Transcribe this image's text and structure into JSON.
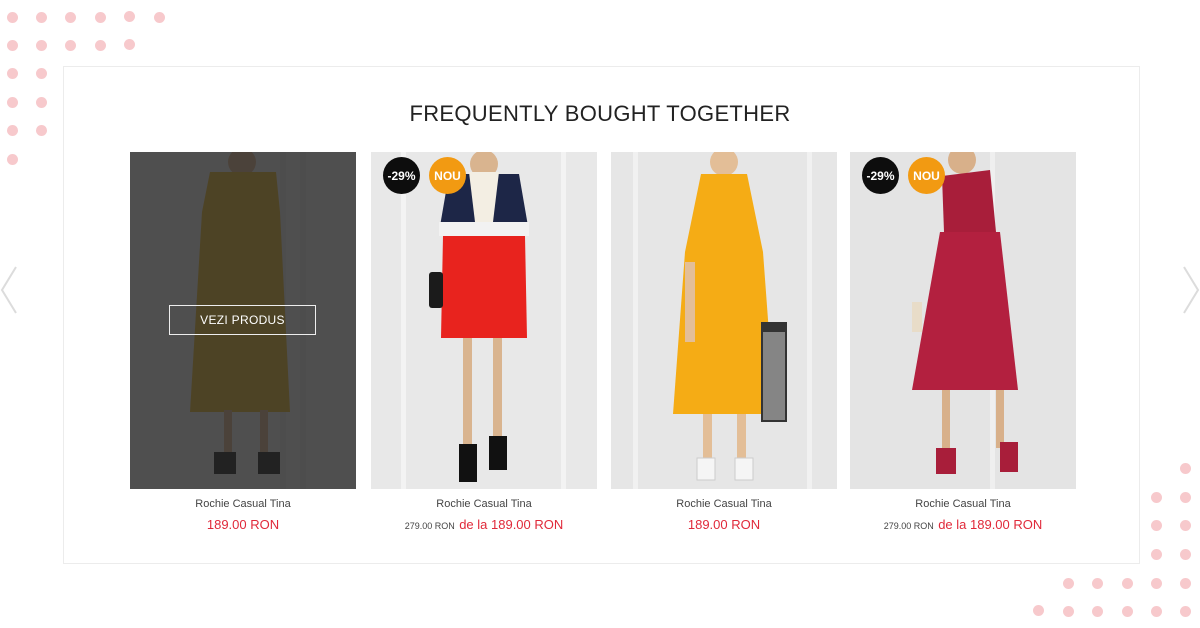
{
  "section": {
    "title": "FREQUENTLY BOUGHT TOGETHER"
  },
  "colors": {
    "accent_red": "#e0293a",
    "badge_new": "#f29a12",
    "badge_discount": "#0d0d0d",
    "decor_dots": "#f7c9cc"
  },
  "icons": {
    "prev": "chevron-left-icon",
    "next": "chevron-right-icon"
  },
  "products": [
    {
      "name": "Rochie Casual Tina",
      "price": "189.00 RON",
      "old_price": "",
      "discount_badge": "",
      "new_badge": "",
      "hover_button": "VEZI PRODUS"
    },
    {
      "name": "Rochie Casual Tina",
      "price": "de la 189.00 RON",
      "old_price": "279.00 RON",
      "discount_badge": "-29%",
      "new_badge": "NOU"
    },
    {
      "name": "Rochie Casual Tina",
      "price": "189.00 RON",
      "old_price": "",
      "discount_badge": "",
      "new_badge": ""
    },
    {
      "name": "Rochie Casual Tina",
      "price": "de la 189.00 RON",
      "old_price": "279.00 RON",
      "discount_badge": "-29%",
      "new_badge": "NOU"
    }
  ]
}
